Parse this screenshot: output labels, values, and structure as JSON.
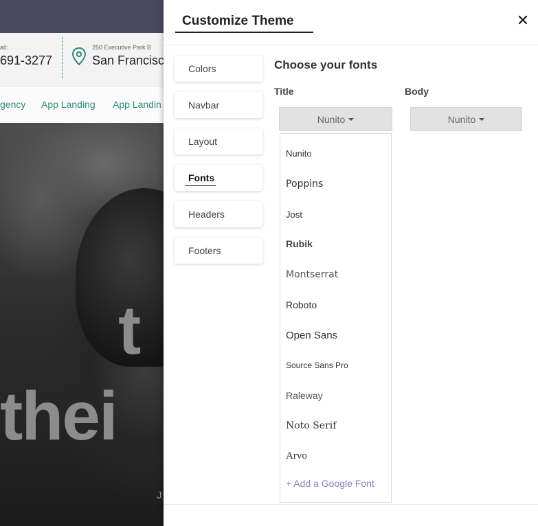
{
  "background_site": {
    "call_label": "all:",
    "phone": "691-3277",
    "address": "250 Executive Park B",
    "city": "San Francisco",
    "nav_items": [
      "gency",
      "App Landing",
      "App Landin"
    ],
    "hero_line1": "t",
    "hero_line2": "thei",
    "hero_small": "J"
  },
  "panel": {
    "title": "Customize Theme",
    "close_label": "✕",
    "tabs": [
      {
        "label": "Colors"
      },
      {
        "label": "Navbar"
      },
      {
        "label": "Layout"
      },
      {
        "label": "Fonts"
      },
      {
        "label": "Headers"
      },
      {
        "label": "Footers"
      }
    ],
    "active_tab": "Fonts",
    "fonts_section": {
      "heading": "Choose your fonts",
      "title_label": "Title",
      "body_label": "Body",
      "title_selected": "Nunito",
      "body_selected": "Nunito",
      "options": [
        "Nunito",
        "Poppins",
        "Jost",
        "Rubik",
        "Montserrat",
        "Roboto",
        "Open Sans",
        "Source Sans Pro",
        "Raleway",
        "Noto Serif",
        "Arvo"
      ],
      "add_font_label": "+ Add a Google Font"
    }
  },
  "colors": {
    "topbar": "#4a4861",
    "nav_link": "#2f8a77",
    "add_font_link": "#8a7fc0",
    "dropdown_bg": "#e2e2e2"
  }
}
